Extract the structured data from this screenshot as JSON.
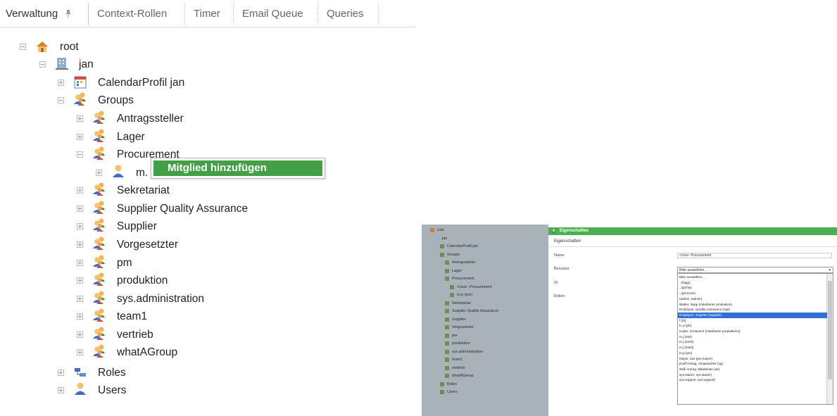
{
  "tabs": [
    {
      "label": "Verwaltung",
      "active": true
    },
    {
      "label": "Context-Rollen"
    },
    {
      "label": "Timer"
    },
    {
      "label": "Email Queue"
    },
    {
      "label": "Queries"
    }
  ],
  "tree": {
    "root": "root",
    "user": "jan",
    "calendar": "CalendarProfil jan",
    "groups_label": "Groups",
    "groups": [
      "Antragssteller",
      "Lager",
      "Procurement"
    ],
    "member": "m.",
    "groups_after": [
      "Sekretariat",
      "Supplier Quality Assurance",
      "Supplier",
      "Vorgesetzter",
      "pm",
      "produktion",
      "sys.administration",
      "team1",
      "vertrieb",
      "whatAGroup"
    ],
    "roles": "Roles",
    "users": "Users"
  },
  "context_menu": {
    "item": "Mitglied hinzufügen"
  },
  "colors": {
    "accent_green": "#43a047",
    "selection_blue": "#2f6fd6"
  },
  "thumbnail": {
    "tree": [
      "root",
      "jan",
      "CalendarProfil jan",
      "Groups",
      "Antragssteller",
      "Lager",
      "Procurement",
      "<User -Procurement",
      "m.p (pm)",
      "Sekretariat",
      "Supplier Quality Assurance",
      "Supplier",
      "Vorgesetzter",
      "pm",
      "produktion",
      "sys.administration",
      "team1",
      "vertrieb",
      "whatAGroup",
      "Roles",
      "Users"
    ],
    "panel_title": "Eigenschaften",
    "panel_tab": "Eigenschaften",
    "fields": {
      "name": "Name",
      "name_value": "<User -Procurement",
      "user": "Benutzer",
      "id": "ID",
      "roles": "Rollen"
    },
    "select_value": "Bitte auswählen...",
    "options": [
      "Bitte auswählen...",
      "../(lagp)",
      "../(pchw)",
      "../(process)",
      "(admin, (admin)",
      "Blatter, Sepp (mitarbeiter produktion)",
      "Employee, Quality Assurance (sqa)",
      "Employee, Supplier (supplier)",
      "f (f2)",
      "h, p (ph)",
      "Huber, Schaurich (mitarbeiter produktion2)",
      "m.j (test)",
      "m.j (test2)",
      "m.j (test3)",
      "m.p (pm)",
      "Mayer, Jan (jan.mayer)",
      "jmaff Antrag, Vorgesetzter (vg)",
      "stelli Antrag, Mitarbeiter (ae)",
      "sys.starter, sys.starter)",
      "sys.support, sys.support)"
    ],
    "selected_index": 7
  }
}
